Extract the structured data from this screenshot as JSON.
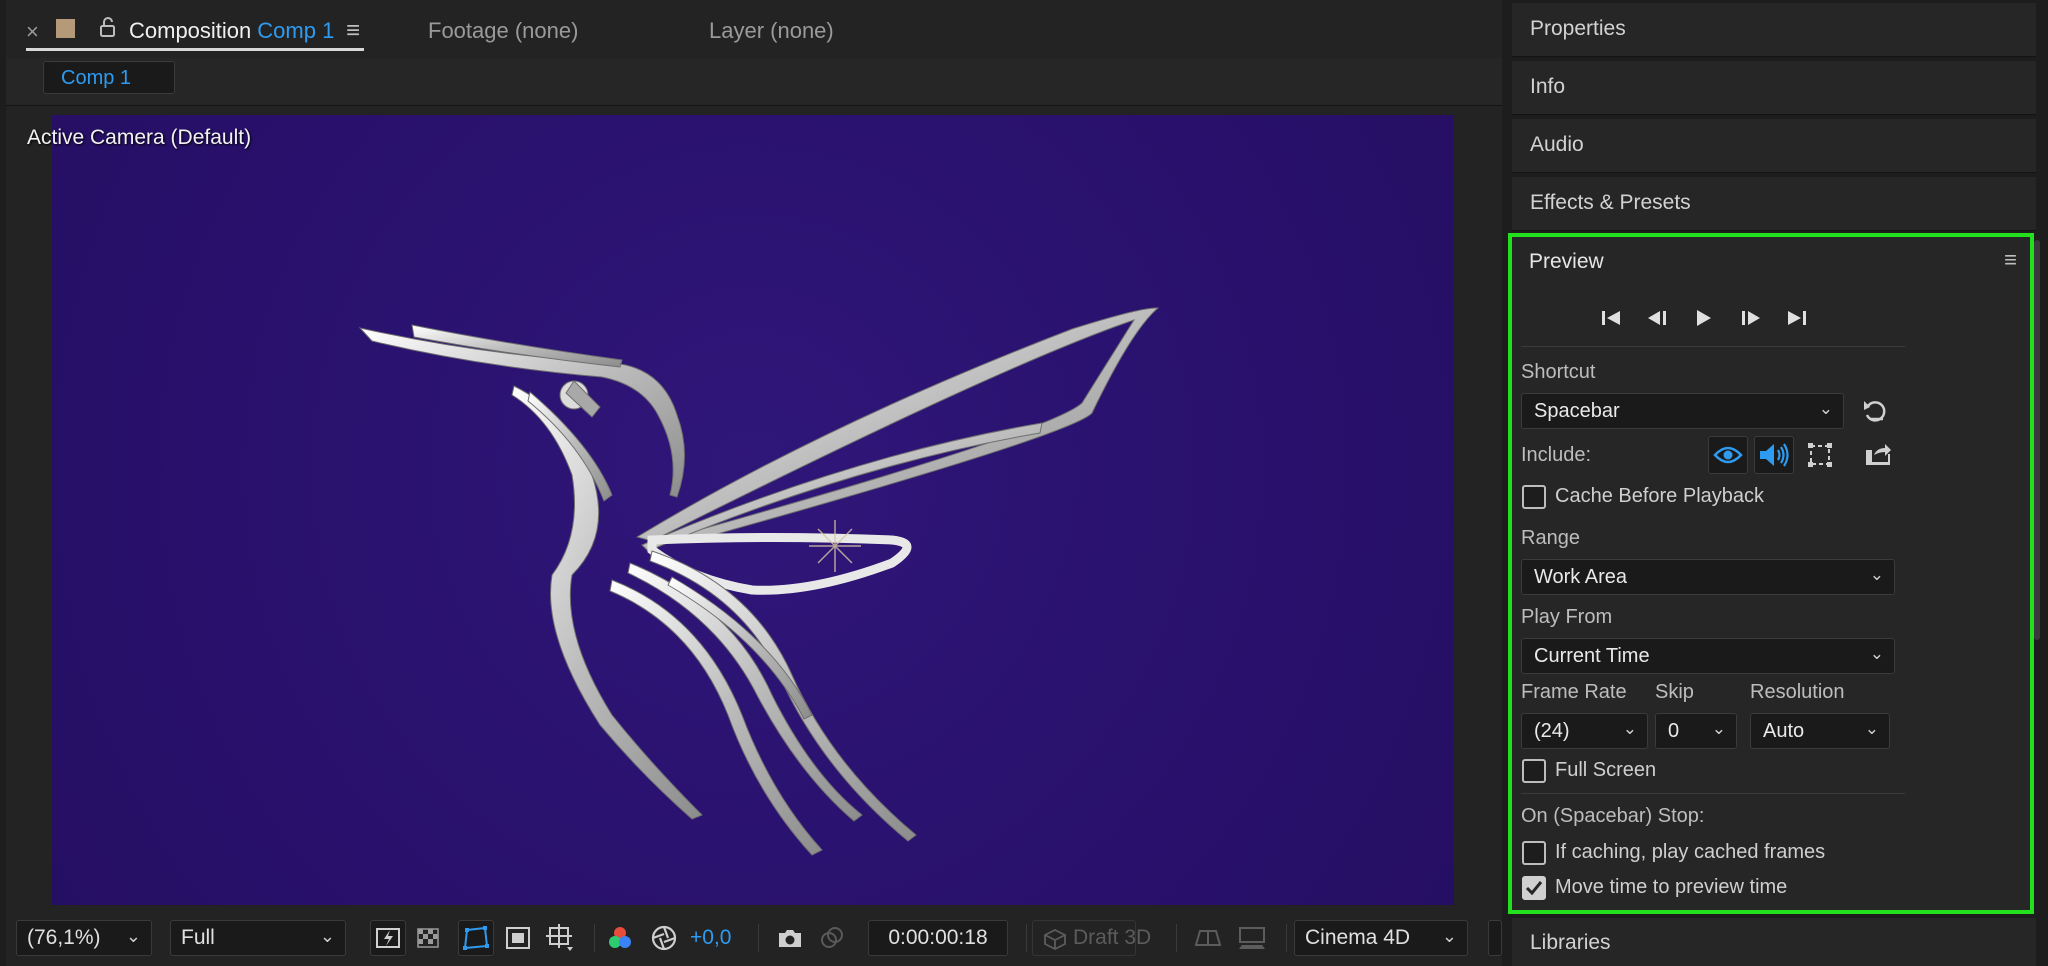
{
  "composition_tab": {
    "label": "Composition",
    "comp_name": "Comp 1",
    "close_glyph": "×",
    "menu_glyph": "≡",
    "footage_tab": "Footage (none)",
    "layer_tab": "Layer (none)"
  },
  "comp_subtab": {
    "label": "Comp 1"
  },
  "viewer": {
    "camera_label": "Active Camera (Default)",
    "background_color": "#2a126e"
  },
  "viewer_bottom": {
    "zoom": "(76,1%)",
    "resolution": "Full",
    "exposure": "+0,0",
    "timecode": "0:00:00:18",
    "draft3d": "Draft 3D",
    "renderer": "Cinema 4D",
    "chevron": "⌄"
  },
  "right_panels": {
    "properties": "Properties",
    "info": "Info",
    "audio": "Audio",
    "effects": "Effects & Presets",
    "libraries": "Libraries"
  },
  "preview": {
    "title": "Preview",
    "menu_glyph": "≡",
    "shortcut_label": "Shortcut",
    "shortcut_value": "Spacebar",
    "include_label": "Include:",
    "cache_before_playback": {
      "label": "Cache Before Playback",
      "checked": false
    },
    "range_label": "Range",
    "range_value": "Work Area",
    "play_from_label": "Play From",
    "play_from_value": "Current Time",
    "frame_rate_label": "Frame Rate",
    "frame_rate_value": "(24)",
    "skip_label": "Skip",
    "skip_value": "0",
    "resolution_label": "Resolution",
    "resolution_value": "Auto",
    "full_screen": {
      "label": "Full Screen",
      "checked": false
    },
    "on_stop_label": "On (Spacebar) Stop:",
    "if_caching": {
      "label": "If caching, play cached frames",
      "checked": false
    },
    "move_time": {
      "label": "Move time to preview time",
      "checked": true
    },
    "chevron": "⌄",
    "accent_color": "#2e9bf0",
    "highlight_color": "#22e01e"
  }
}
